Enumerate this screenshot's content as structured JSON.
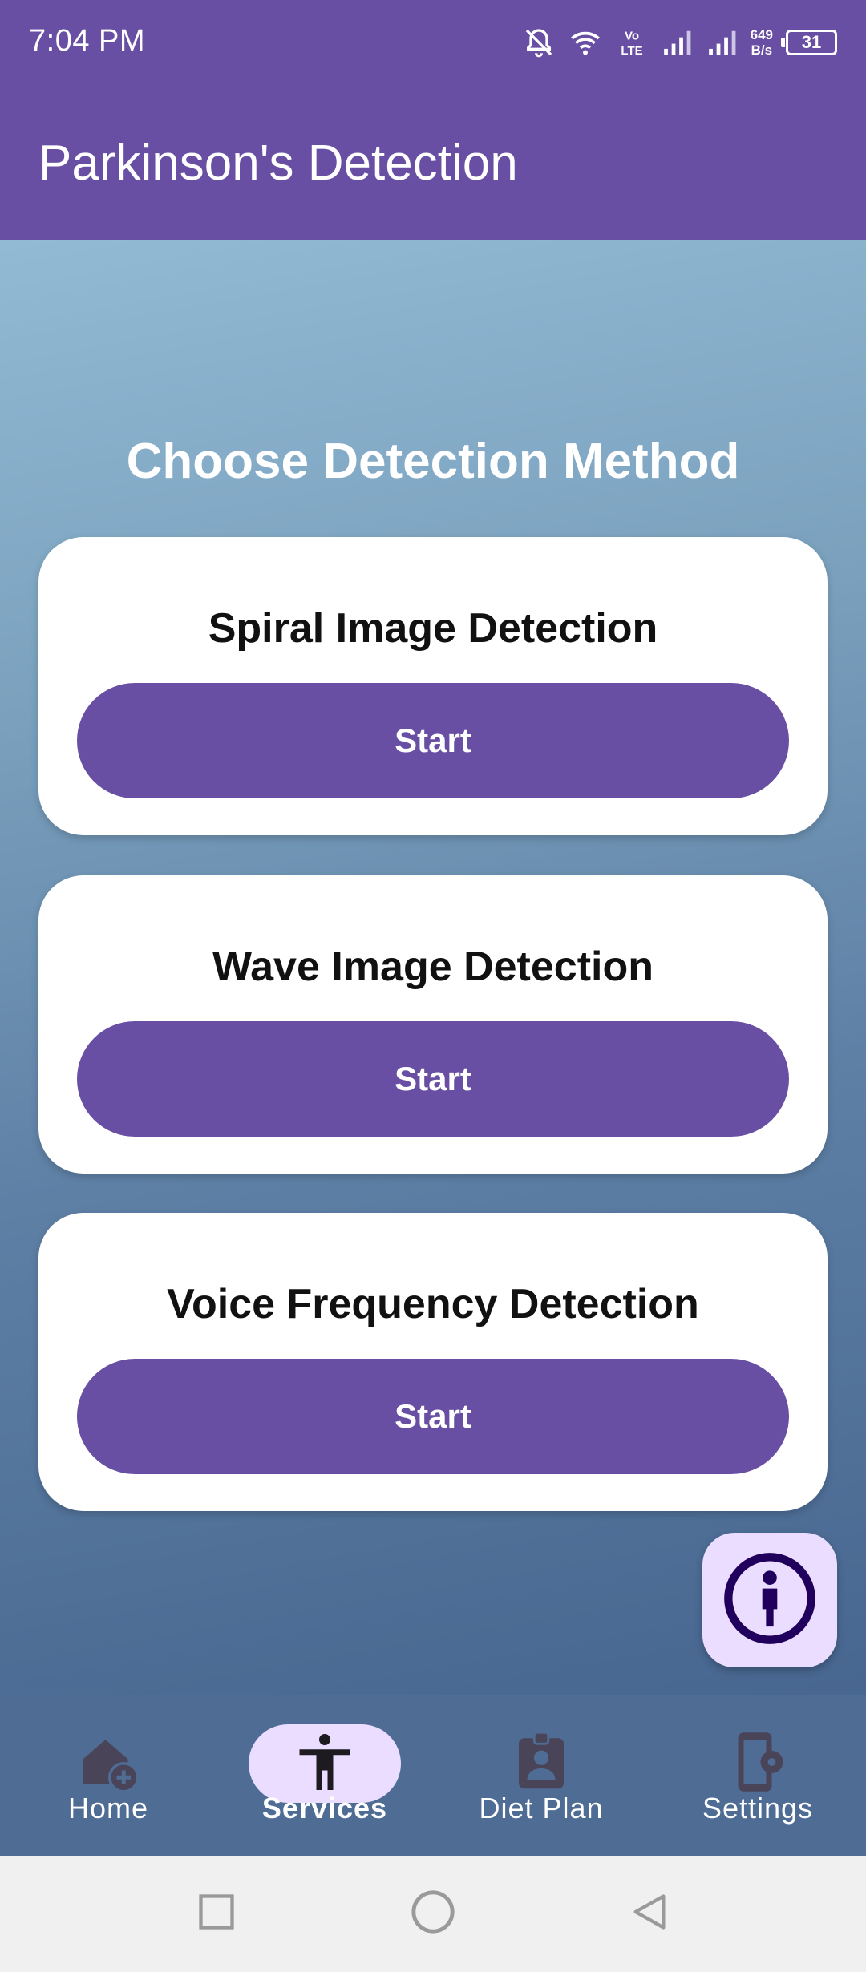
{
  "status_bar": {
    "time": "7:04 PM",
    "net_speed_value": "649",
    "net_speed_unit": "B/s",
    "battery_level": "31",
    "icons": [
      "bell-off-icon",
      "wifi-icon",
      "volte-icon",
      "signal-icon",
      "signal-icon",
      "battery-icon"
    ]
  },
  "app_bar": {
    "title": "Parkinson's Detection"
  },
  "main": {
    "heading": "Choose Detection Method",
    "cards": [
      {
        "title": "Spiral Image Detection",
        "button_label": "Start"
      },
      {
        "title": "Wave Image Detection",
        "button_label": "Start"
      },
      {
        "title": "Voice Frequency Detection",
        "button_label": "Start"
      }
    ],
    "fab_icon": "accessibility-info-icon"
  },
  "bottom_nav": {
    "items": [
      {
        "label": "Home",
        "icon": "home-add-icon",
        "active": false
      },
      {
        "label": "Services",
        "icon": "accessibility-icon",
        "active": true
      },
      {
        "label": "Diet Plan",
        "icon": "badge-icon",
        "active": false
      },
      {
        "label": "Settings",
        "icon": "phone-settings-icon",
        "active": false
      }
    ]
  },
  "colors": {
    "primary": "#684fa4",
    "active_indicator": "#eaddff",
    "gradient_top": "#92bad4",
    "gradient_bottom": "#476690",
    "nav_background": "#4f6c95"
  }
}
